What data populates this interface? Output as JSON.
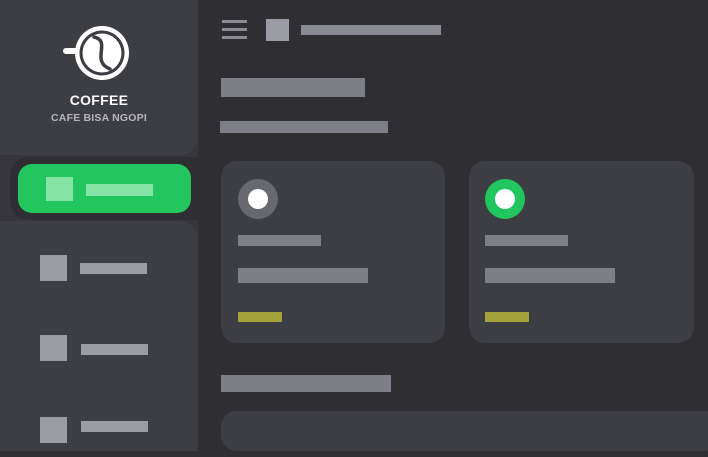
{
  "brand": {
    "title": "COFFEE",
    "subtitle": "CAFE BISA NGOPI",
    "logo_icon": "coffee-cup-icon",
    "logo_color": "#ffffff"
  },
  "colors": {
    "accent": "#22c55e",
    "tag": "#a3a33c",
    "status_neutral": "#68686f",
    "status_active": "#22c55e"
  },
  "sidebar": {
    "items": [
      {
        "icon": "nav-icon",
        "active": true
      },
      {
        "icon": "nav-icon",
        "active": false
      },
      {
        "icon": "nav-icon",
        "active": false
      },
      {
        "icon": "nav-icon",
        "active": false
      }
    ]
  },
  "header": {
    "menu_icon": "hamburger-icon"
  },
  "cards": [
    {
      "status": "neutral",
      "status_icon": "status-dot-icon"
    },
    {
      "status": "active",
      "status_icon": "status-dot-icon"
    }
  ]
}
